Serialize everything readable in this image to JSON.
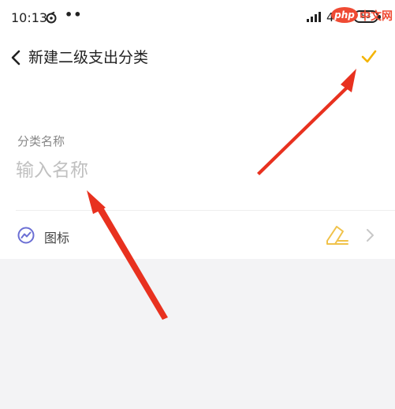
{
  "status_bar": {
    "time": "10:13",
    "dots": "••",
    "network": "4G",
    "network_sub": "ill",
    "battery": "83"
  },
  "header": {
    "title": "新建二级支出分类",
    "back_icon": "chevron-left-icon",
    "confirm_icon": "checkmark-icon",
    "confirm_color": "#f4b400"
  },
  "form": {
    "name_label": "分类名称",
    "name_placeholder": "输入名称",
    "name_value": "",
    "icon_row": {
      "label": "图标",
      "leading_icon": "trend-circle-icon",
      "leading_icon_color": "#6b6fd4",
      "edit_icon": "pencil-edit-icon",
      "edit_icon_color": "#f0c24a",
      "trailing_icon": "chevron-right-icon"
    }
  },
  "annotations": {
    "arrow_color": "#e8311f"
  },
  "watermark": {
    "brand": "php",
    "suffix": "中文网"
  }
}
